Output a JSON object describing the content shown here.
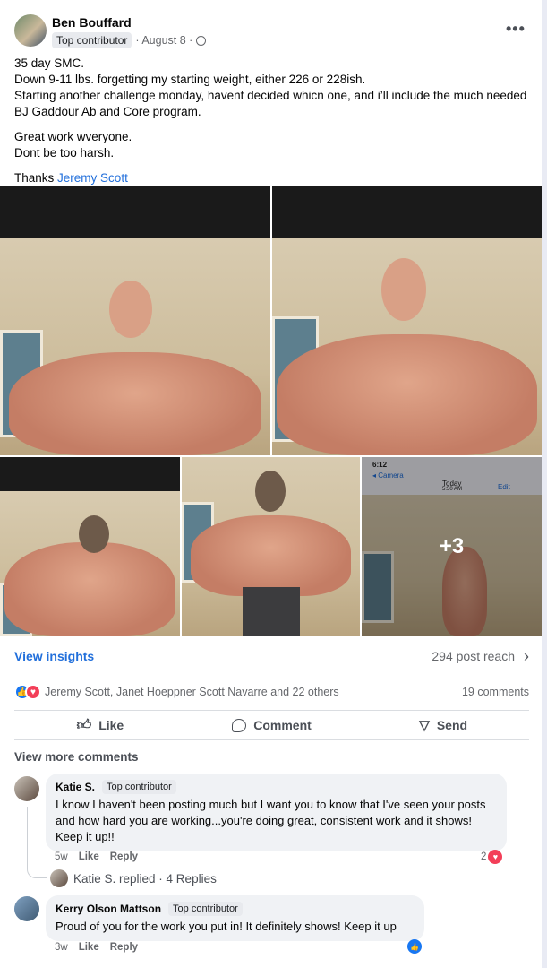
{
  "post": {
    "author": "Ben Bouffard",
    "badge": "Top contributor",
    "date": "· August 8 ·",
    "more_label": "•••",
    "lines": [
      "35 day SMC.",
      "Down 9-11 lbs. forgetting my starting weight, either 226 or 228ish.",
      "Starting another challenge monday, havent decided whicn one, and i’ll include the much needed BJ Gaddour Ab and Core program."
    ],
    "lines2": [
      "Great work wveryone.",
      "Dont be too harsh."
    ],
    "thanks": "Thanks",
    "thanks_link": "Jeremy Scott"
  },
  "photos": {
    "more_count": "+3",
    "phone_time": "6:12",
    "phone_back": "◂ Camera",
    "phone_today": "Today",
    "phone_clock": "5:50 AM",
    "phone_edit": "Edit"
  },
  "stats": {
    "insights": "View insights",
    "reach": "294 post reach",
    "reactors": "Jeremy Scott, Janet Hoeppner Scott Navarre and 22 others",
    "comments_count": "19 comments"
  },
  "actions": {
    "like": "Like",
    "comment": "Comment",
    "send": "Send"
  },
  "comments": {
    "view_more": "View more comments",
    "items": [
      {
        "name": "Katie S.",
        "badge": "Top contributor",
        "text": "I know I haven't been posting much but I want you to know that I've seen your posts and how hard you are working...you're doing great, consistent work and it shows! Keep it up!!",
        "age": "5w",
        "like": "Like",
        "reply": "Reply",
        "reactions": "2"
      },
      {
        "name": "Kerry Olson Mattson",
        "badge": "Top contributor",
        "text": "Proud of you for the work you put in! It definitely shows! Keep it up",
        "age": "3w",
        "like": "Like",
        "reply": "Reply"
      }
    ],
    "replied": "Katie S. replied · 4 Replies"
  },
  "colors": {
    "accent": "#216fdb",
    "love": "#f33e58",
    "like": "#1877f2"
  }
}
